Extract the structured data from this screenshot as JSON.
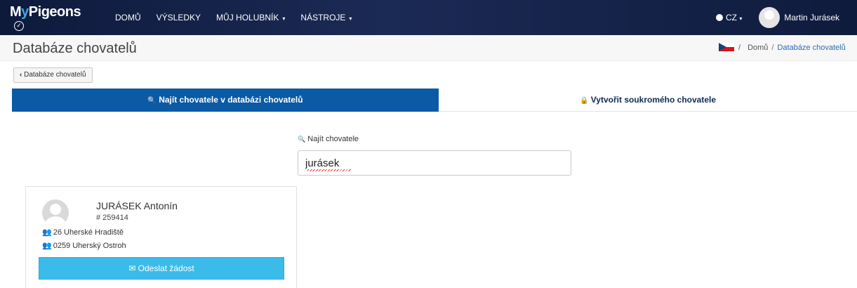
{
  "navbar": {
    "logo_m": "M",
    "logo_v": "y",
    "logo_rest": "Pigeons",
    "items": [
      {
        "label": "DOMŮ",
        "caret": ""
      },
      {
        "label": "VÝSLEDKY",
        "caret": ""
      },
      {
        "label": "MŮJ HOLUBNÍK",
        "caret": "▾"
      },
      {
        "label": "NÁSTROJE",
        "caret": "▾"
      }
    ],
    "language": "CZ",
    "language_caret": "▾",
    "user_name": "Martin Jurásek"
  },
  "page": {
    "title": "Databáze chovatelů",
    "breadcrumb": {
      "sep": "/",
      "home": "Domů",
      "current": "Databáze chovatelů"
    }
  },
  "back_button": {
    "icon": "‹",
    "label": "Databáze chovatelů"
  },
  "tabs": {
    "find": {
      "icon": "🔍",
      "label": "Najít chovatele v databázi chovatelů"
    },
    "create": {
      "icon": "🔒",
      "label": "Vytvořit soukromého chovatele"
    }
  },
  "search": {
    "icon": "🔍",
    "label": "Najít chovatele",
    "value": "jurásek"
  },
  "results": [
    {
      "name": "JURÁSEK Antonín",
      "id": "# 259414",
      "org_1": "26 Uherské Hradiště",
      "org_2": "0259 Uherský Ostroh",
      "button_icon": "✉",
      "button_label": "Odeslat žádost"
    }
  ],
  "colors": {
    "navbar": "#1b2a55",
    "tab_active": "#0a5aa6",
    "send_button": "#3bbbea",
    "org_1_icon": "#b05acb",
    "org_2_icon": "#1f7fd1"
  }
}
